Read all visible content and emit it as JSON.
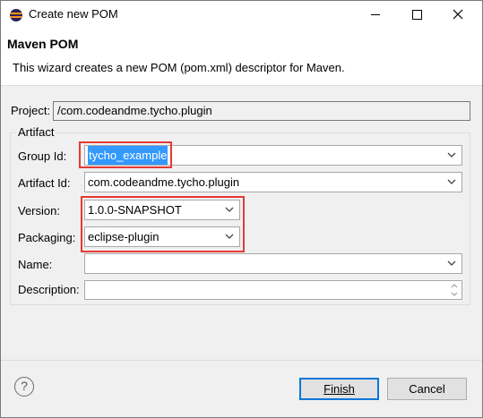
{
  "window": {
    "title": "Create new POM",
    "controls": {
      "minimize": "minimize-icon",
      "maximize": "maximize-icon",
      "close": "close-icon"
    }
  },
  "header": {
    "title": "Maven POM",
    "description": "This wizard creates a new POM (pom.xml) descriptor for Maven."
  },
  "project": {
    "label": "Project:",
    "value": "/com.codeandme.tycho.plugin"
  },
  "artifact": {
    "legend": "Artifact",
    "group_id": {
      "label": "Group Id:",
      "value": "tycho_example"
    },
    "artifact_id": {
      "label": "Artifact Id:",
      "value": "com.codeandme.tycho.plugin"
    },
    "version": {
      "label": "Version:",
      "value": "1.0.0-SNAPSHOT"
    },
    "packaging": {
      "label": "Packaging:",
      "value": "eclipse-plugin"
    },
    "name": {
      "label": "Name:",
      "value": ""
    },
    "description": {
      "label": "Description:",
      "value": ""
    }
  },
  "footer": {
    "help": "?",
    "finish_label": "Finish",
    "cancel_label": "Cancel"
  },
  "colors": {
    "selection": "#3399ff",
    "highlight": "#e53935",
    "default_button_border": "#0078d7"
  }
}
